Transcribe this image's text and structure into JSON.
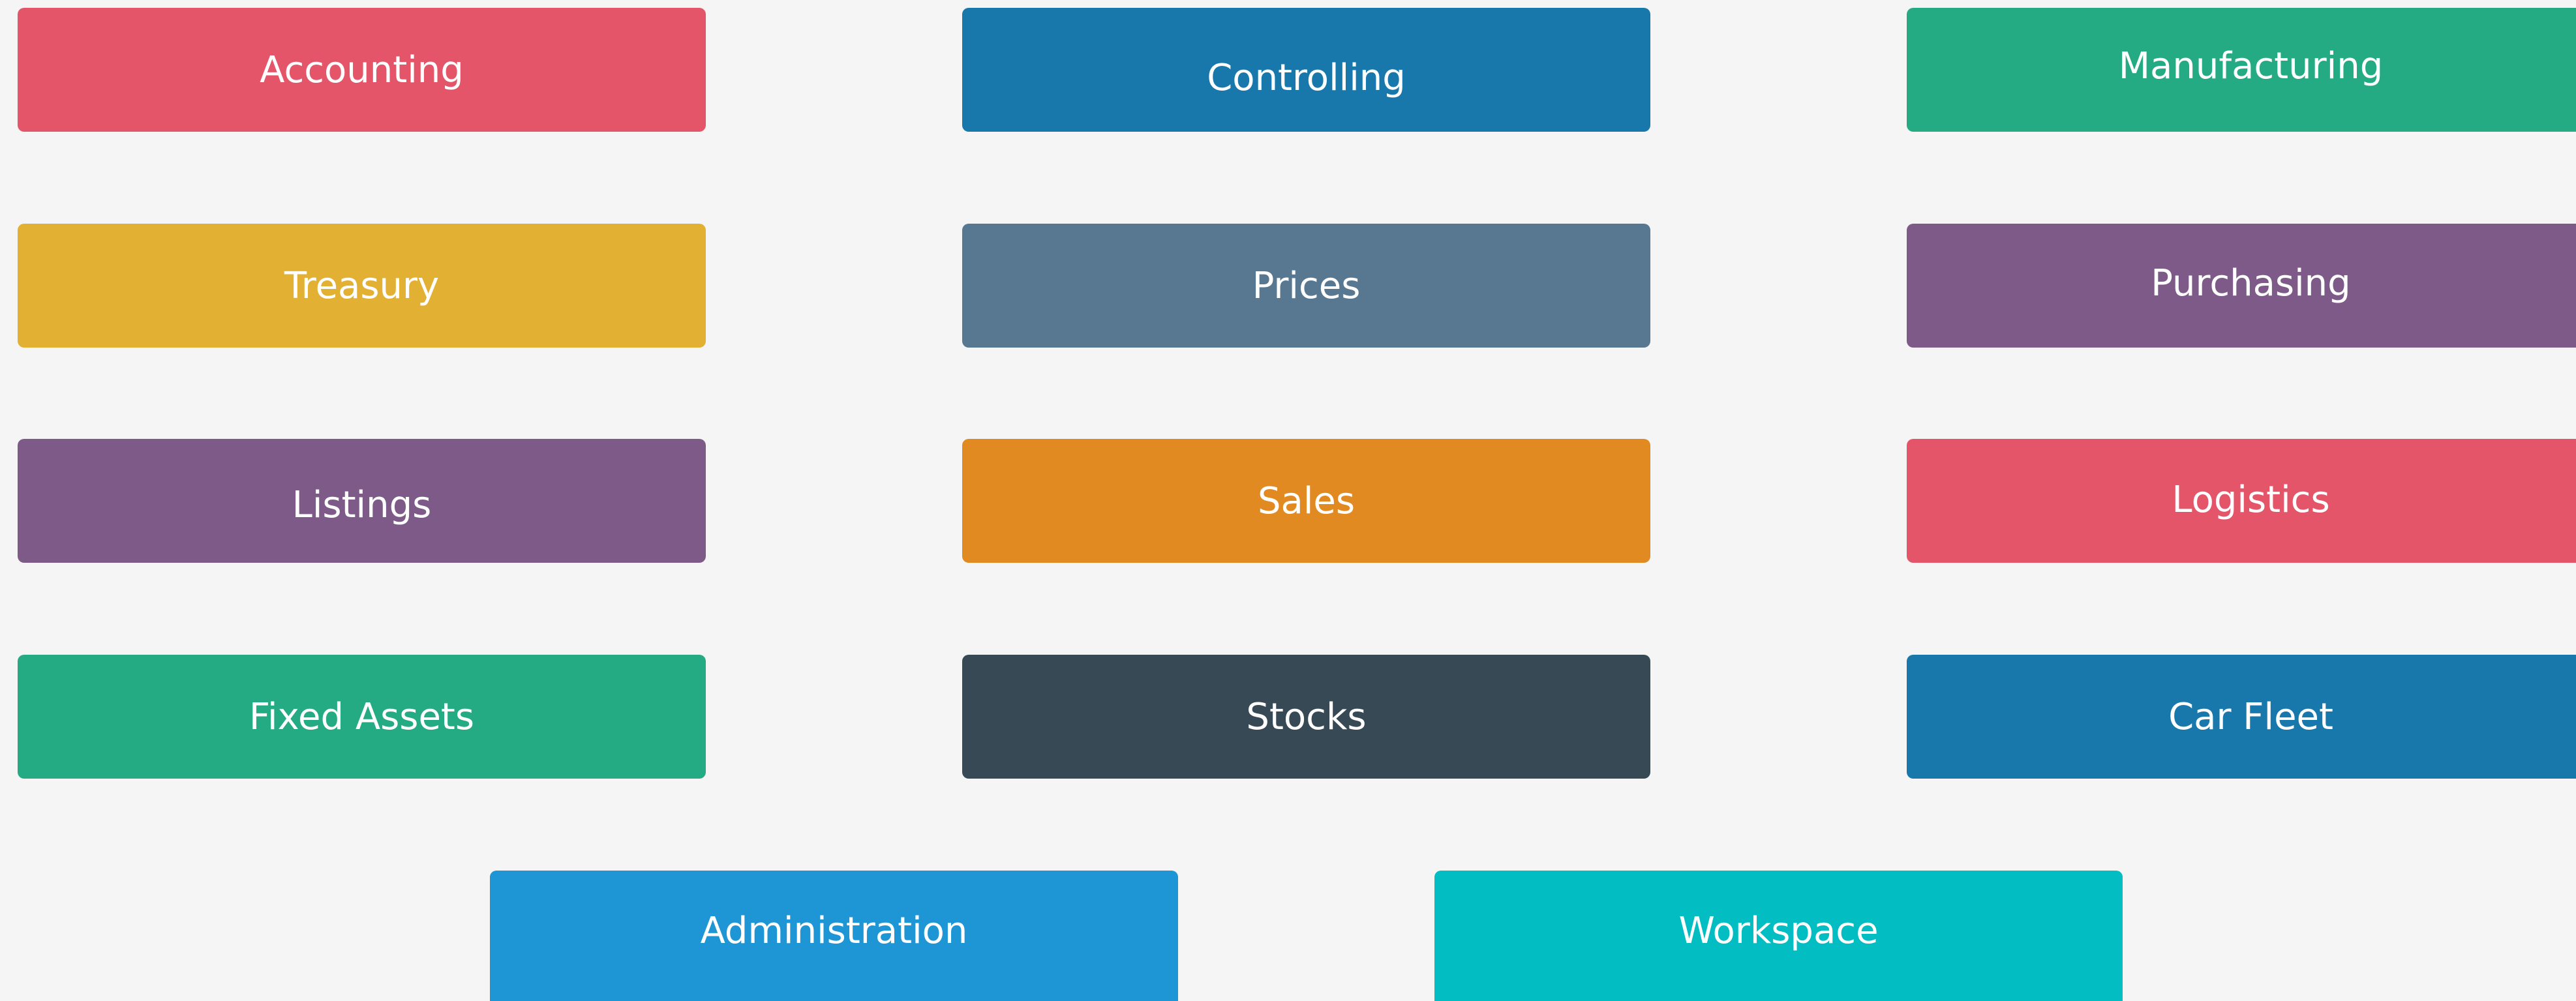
{
  "tiles": [
    {
      "id": "accounting",
      "label": "Accounting",
      "color": "#e45569"
    },
    {
      "id": "controlling",
      "label": "Controlling",
      "color": "#1878ab"
    },
    {
      "id": "manufacturing",
      "label": "Manufacturing",
      "color": "#25ab83"
    },
    {
      "id": "treasury",
      "label": "Treasury",
      "color": "#e2b033"
    },
    {
      "id": "prices",
      "label": "Prices",
      "color": "#587891"
    },
    {
      "id": "purchasing",
      "label": "Purchasing",
      "color": "#7e5a88"
    },
    {
      "id": "listings",
      "label": "Listings",
      "color": "#7e5a88"
    },
    {
      "id": "sales",
      "label": "Sales",
      "color": "#e28a22"
    },
    {
      "id": "logistics",
      "label": "Logistics",
      "color": "#e45569"
    },
    {
      "id": "fixed_assets",
      "label": "Fixed Assets",
      "color": "#25ab83"
    },
    {
      "id": "stocks",
      "label": "Stocks",
      "color": "#364955"
    },
    {
      "id": "car_fleet",
      "label": "Car Fleet",
      "color": "#1878ab"
    },
    {
      "id": "administration",
      "label": "Administration",
      "color": "#1e96d5"
    },
    {
      "id": "workspace",
      "label": "Workspace",
      "color": "#02bdc2"
    }
  ],
  "background_color": "#f5f5f5"
}
